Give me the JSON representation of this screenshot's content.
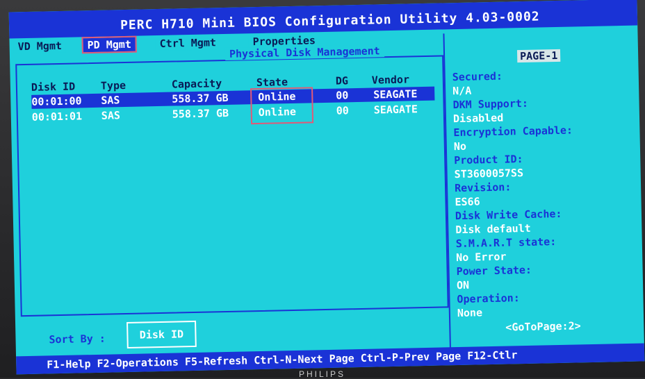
{
  "title": "PERC H710 Mini BIOS Configuration Utility 4.03-0002",
  "tabs": [
    "VD Mgmt",
    "PD Mgmt",
    "Ctrl Mgmt",
    "Properties"
  ],
  "panel_title": "Physical Disk Management",
  "columns": [
    "Disk ID",
    "Type",
    "Capacity",
    "State",
    "DG",
    "Vendor"
  ],
  "rows": [
    {
      "disk_id": "00:01:00",
      "type": "SAS",
      "capacity": "558.37 GB",
      "state": "Online",
      "dg": "00",
      "vendor": "SEAGATE"
    },
    {
      "disk_id": "00:01:01",
      "type": "SAS",
      "capacity": "558.37 GB",
      "state": "Online",
      "dg": "00",
      "vendor": "SEAGATE"
    }
  ],
  "page_label": "PAGE-1",
  "properties": [
    {
      "label": "Secured:",
      "value": "N/A"
    },
    {
      "label": "DKM Support:",
      "value": "Disabled"
    },
    {
      "label": "Encryption Capable:",
      "value": "No"
    },
    {
      "label": "Product ID:",
      "value": "ST3600057SS"
    },
    {
      "label": "Revision:",
      "value": "ES66"
    },
    {
      "label": "Disk Write Cache:",
      "value": "Disk default"
    },
    {
      "label": "S.M.A.R.T state:",
      "value": "No Error"
    },
    {
      "label": "Power State:",
      "value": "ON"
    },
    {
      "label": "Operation:",
      "value": "None"
    }
  ],
  "sort_by": {
    "label": "Sort By :",
    "value": "Disk ID"
  },
  "goto_page": "<GoToPage:2>",
  "footer": "F1-Help F2-Operations F5-Refresh Ctrl-N-Next Page Ctrl-P-Prev Page F12-Ctlr",
  "monitor_brand": "PHILIPS",
  "colors": {
    "screen_bg": "#1fd0dc",
    "bar_bg": "#1a33d6",
    "highlight": "#e05a78"
  }
}
